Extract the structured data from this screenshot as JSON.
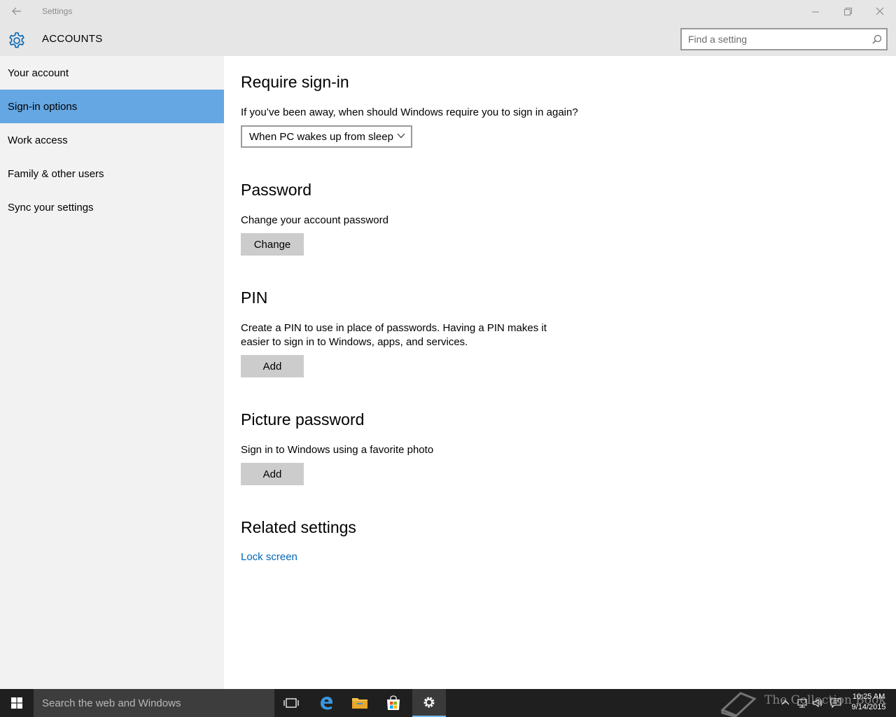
{
  "window": {
    "title": "Settings",
    "controls": [
      "minimize",
      "restore",
      "close"
    ]
  },
  "header": {
    "section_title": "ACCOUNTS",
    "icon": "gear-icon",
    "search_placeholder": "Find a setting"
  },
  "sidebar": {
    "items": [
      {
        "label": "Your account",
        "selected": false
      },
      {
        "label": "Sign-in options",
        "selected": true
      },
      {
        "label": "Work access",
        "selected": false
      },
      {
        "label": "Family & other users",
        "selected": false
      },
      {
        "label": "Sync your settings",
        "selected": false
      }
    ]
  },
  "content": {
    "require_signin": {
      "title": "Require sign-in",
      "question": "If you’ve been away, when should Windows require you to sign in again?",
      "dropdown_value": "When PC wakes up from sleep"
    },
    "password": {
      "title": "Password",
      "description": "Change your account password",
      "button": "Change"
    },
    "pin": {
      "title": "PIN",
      "description_line1": "Create a PIN to use in place of passwords. Having a PIN makes it",
      "description_line2": "easier to sign in to Windows, apps, and services.",
      "button": "Add"
    },
    "picture_password": {
      "title": "Picture password",
      "description": "Sign in to Windows using a favorite photo",
      "button": "Add"
    },
    "related": {
      "title": "Related settings",
      "link": "Lock screen"
    }
  },
  "taskbar": {
    "search_placeholder": "Search the web and Windows",
    "pinned": [
      "task-view-icon",
      "edge-icon",
      "file-explorer-icon",
      "store-icon",
      "settings-icon"
    ],
    "active_app": "settings-icon",
    "clock_time": "10:25 AM",
    "clock_date": "9/14/2015",
    "watermark": "The Collection Book"
  },
  "colors": {
    "accent": "#65a7e2",
    "link": "#0067b8",
    "chrome": "#e6e6e6",
    "sidebar": "#f2f2f2",
    "taskbar": "#1f1f1f"
  }
}
